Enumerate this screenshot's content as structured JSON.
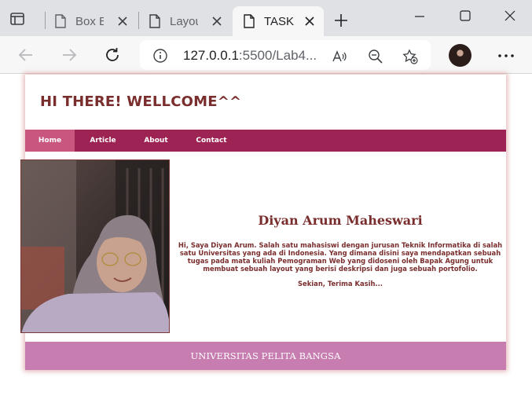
{
  "browser": {
    "tabs": [
      {
        "title": "Box E",
        "active": false
      },
      {
        "title": "Layou",
        "active": false
      },
      {
        "title": "TASK",
        "active": true
      }
    ],
    "url": {
      "host": "127.0.0.1",
      "rest": ":5500/Lab4..."
    },
    "icons": [
      "tab-actions-icon",
      "document-icon",
      "close-icon",
      "plus-icon",
      "minimize-icon",
      "maximize-icon",
      "window-close-icon",
      "back-arrow-icon",
      "forward-arrow-icon",
      "refresh-icon",
      "info-icon",
      "read-aloud-icon",
      "zoom-out-icon",
      "favorite-add-icon",
      "more-icon"
    ]
  },
  "page": {
    "header_title": "HI THERE! WELLCOME^^",
    "nav": [
      {
        "label": "Home",
        "active": true
      },
      {
        "label": "Article",
        "active": false
      },
      {
        "label": "About",
        "active": false
      },
      {
        "label": "Contact",
        "active": false
      }
    ],
    "profile": {
      "name": "Diyan Arum Maheswari",
      "description": "Hi, Saya Diyan Arum. Salah satu mahasiswi dengan jurusan Teknik Informatika di salah satu Universitas yang ada di Indonesia. Yang dimana disini saya mendapatkan sebuah tugas pada mata kuliah Pemograman Web yang didoseni oleh Bapak Agung untuk membuat sebuah layout yang berisi deskripsi dan juga sebuah portofolio.",
      "closing": "Sekian, Terima Kasih..."
    },
    "footer": "UNIVERSITAS PELITA BANGSA"
  },
  "colors": {
    "nav_bg": "#9c2353",
    "nav_active": "#c9567e",
    "heading": "#7a2d2d",
    "footer_bg": "#c77daf"
  }
}
